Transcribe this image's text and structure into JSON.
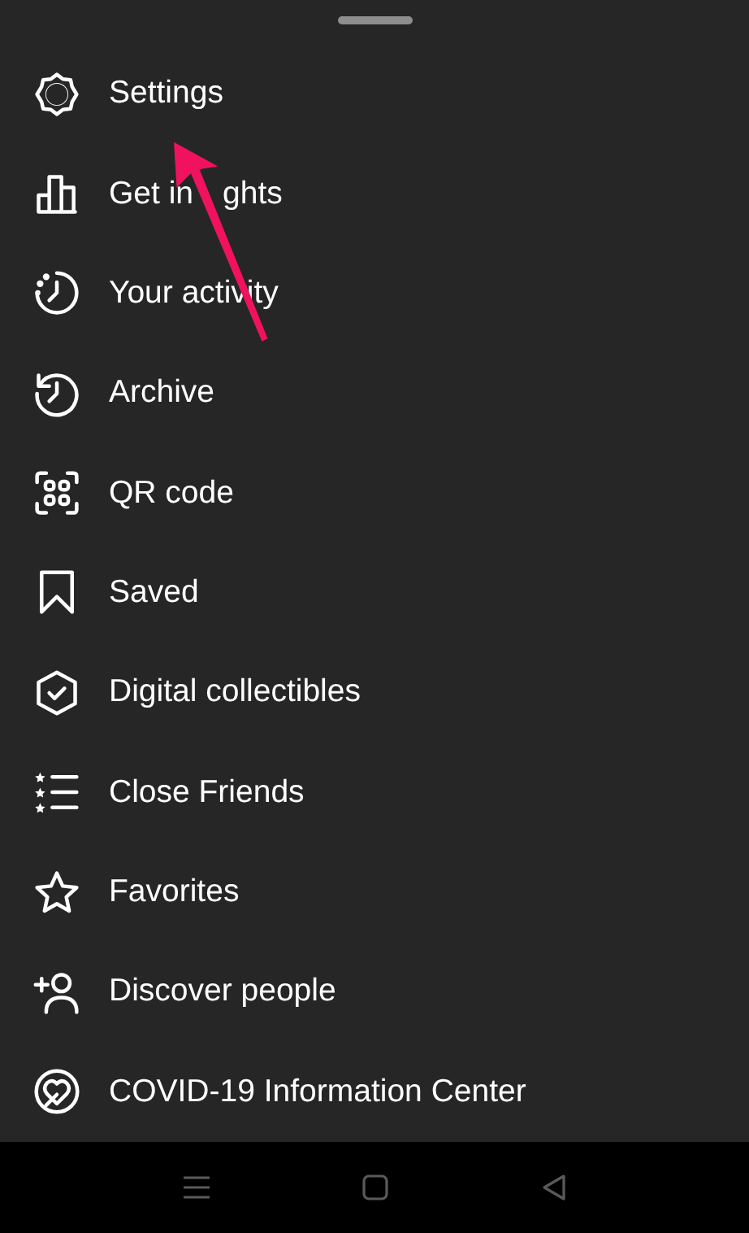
{
  "menu_items": [
    {
      "label": "Settings"
    },
    {
      "label": "Get in",
      "label_after": "ghts"
    },
    {
      "label": "Your activity"
    },
    {
      "label": "Archive"
    },
    {
      "label": "QR code"
    },
    {
      "label": "Saved"
    },
    {
      "label": "Digital collectibles"
    },
    {
      "label": "Close Friends"
    },
    {
      "label": "Favorites"
    },
    {
      "label": "Discover people"
    },
    {
      "label": "COVID-19 Information Center"
    }
  ]
}
